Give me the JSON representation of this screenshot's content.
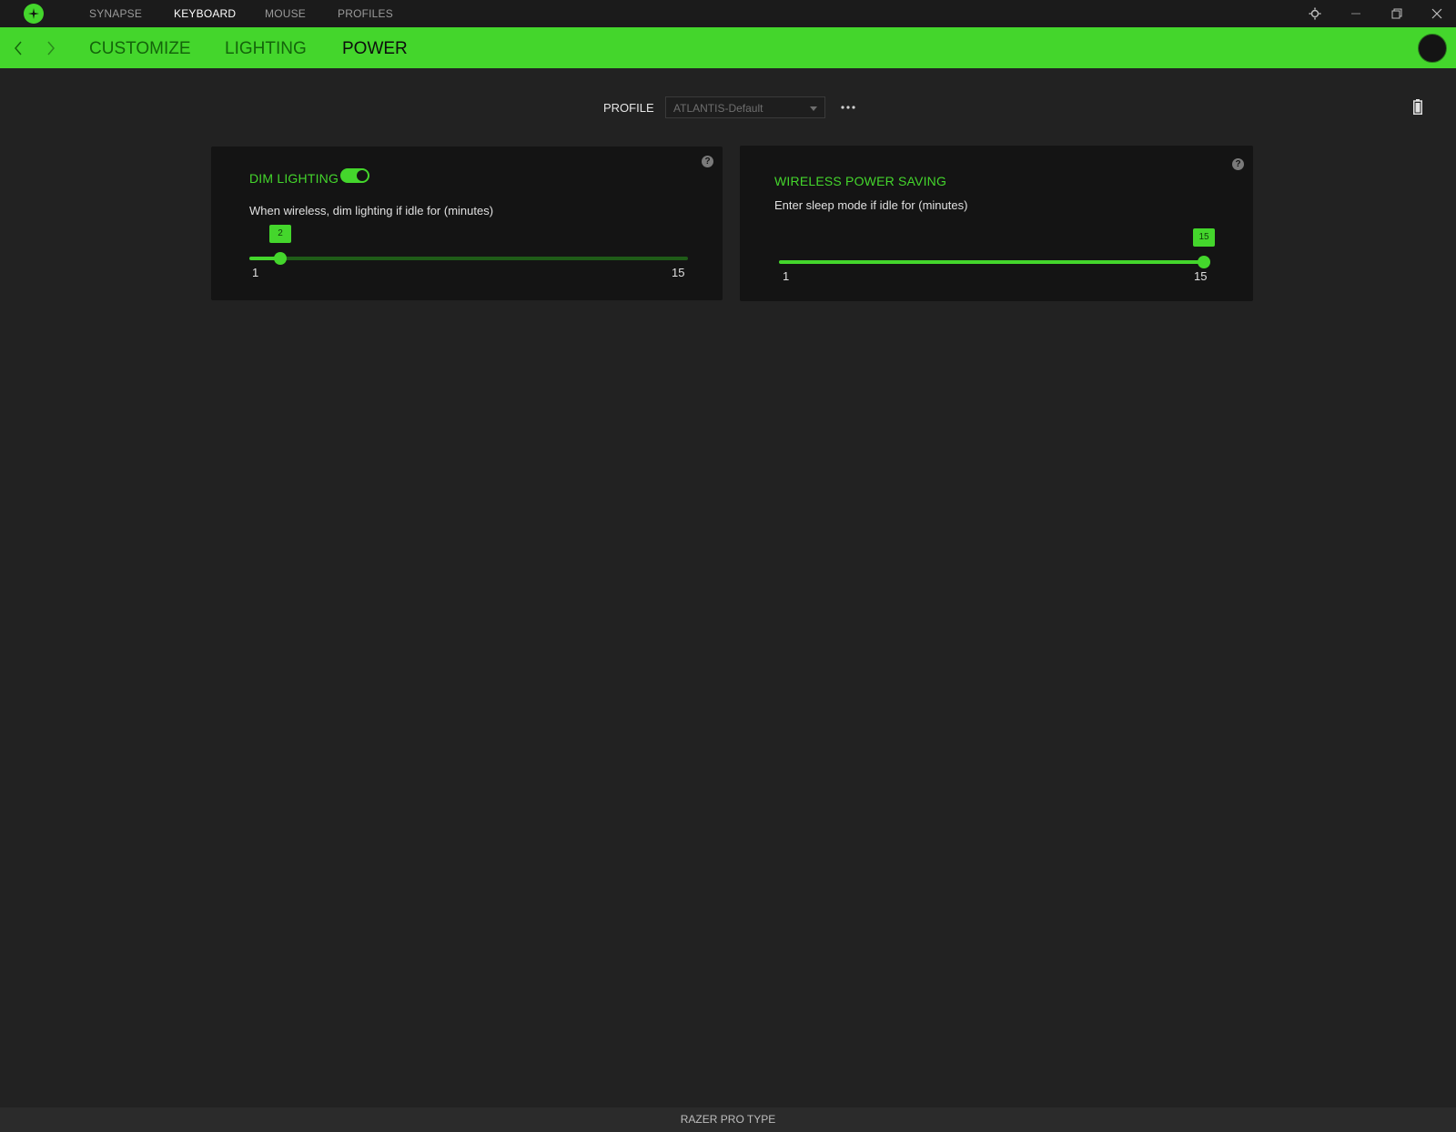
{
  "app": {
    "logo_icon": "razer-logo-icon",
    "main_tabs": [
      {
        "label": "SYNAPSE",
        "active": false
      },
      {
        "label": "KEYBOARD",
        "active": true
      },
      {
        "label": "MOUSE",
        "active": false
      },
      {
        "label": "PROFILES",
        "active": false
      }
    ],
    "window_controls": [
      "settings-icon",
      "minimize-icon",
      "maximize-icon",
      "close-icon"
    ]
  },
  "subnav": {
    "back_icon": "chevron-left-icon",
    "forward_icon": "chevron-right-icon",
    "tabs": [
      {
        "label": "CUSTOMIZE",
        "active": false
      },
      {
        "label": "LIGHTING",
        "active": false
      },
      {
        "label": "POWER",
        "active": true
      }
    ],
    "device_avatar": "device-avatar"
  },
  "profile": {
    "label": "PROFILE",
    "selected": "ATLANTIS-Default",
    "more_icon": "ellipsis-icon",
    "battery_icon": "battery-icon"
  },
  "dim_lighting": {
    "title": "DIM LIGHTING",
    "enabled": true,
    "description": "When wireless, dim lighting if idle for (minutes)",
    "min": 1,
    "max": 15,
    "min_label": "1",
    "max_label": "15",
    "value": 2,
    "value_label": "2",
    "help": "?"
  },
  "wireless_power_saving": {
    "title": "WIRELESS POWER SAVING",
    "description": "Enter sleep mode if idle for (minutes)",
    "min": 1,
    "max": 15,
    "min_label": "1",
    "max_label": "15",
    "value": 15,
    "value_label": "15",
    "help": "?"
  },
  "status": {
    "device_name": "RAZER PRO TYPE"
  },
  "colors": {
    "accent": "#44d62c",
    "background": "#222222",
    "panel": "#141414"
  }
}
